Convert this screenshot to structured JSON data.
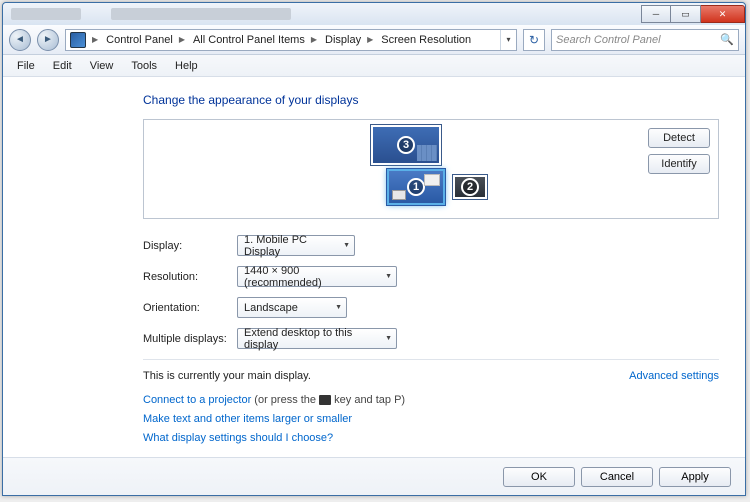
{
  "titlebar": {
    "minimize_tip": "Minimize",
    "maximize_tip": "Maximize",
    "close_tip": "Close"
  },
  "nav": {
    "breadcrumb": [
      "Control Panel",
      "All Control Panel Items",
      "Display",
      "Screen Resolution"
    ],
    "search_placeholder": "Search Control Panel"
  },
  "menubar": [
    "File",
    "Edit",
    "View",
    "Tools",
    "Help"
  ],
  "heading": "Change the appearance of your displays",
  "diagram": {
    "detect": "Detect",
    "identify": "Identify",
    "monitors": {
      "m1": "1",
      "m2": "2",
      "m3": "3"
    }
  },
  "form": {
    "display_label": "Display:",
    "display_value": "1. Mobile PC Display",
    "resolution_label": "Resolution:",
    "resolution_value": "1440 × 900 (recommended)",
    "orientation_label": "Orientation:",
    "orientation_value": "Landscape",
    "multiple_label": "Multiple displays:",
    "multiple_value": "Extend desktop to this display"
  },
  "status": {
    "main_display": "This is currently your main display.",
    "advanced": "Advanced settings"
  },
  "links": {
    "projector_link": "Connect to a projector",
    "projector_hint_pre": " (or press the ",
    "projector_hint_post": " key and tap P)",
    "textsize": "Make text and other items larger or smaller",
    "whichsettings": "What display settings should I choose?"
  },
  "footer": {
    "ok": "OK",
    "cancel": "Cancel",
    "apply": "Apply"
  }
}
